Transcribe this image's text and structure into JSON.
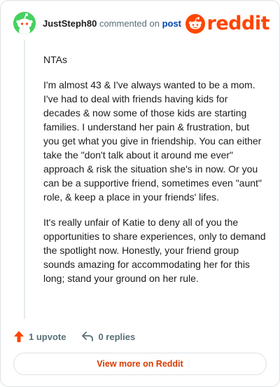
{
  "header": {
    "username": "JustSteph80",
    "verb": "commented on",
    "post_link": "post",
    "logo_text": "reddit"
  },
  "comment": {
    "paragraphs": [
      "NTAs",
      "I'm almost 43 & I've always wanted to be a mom. I've had to deal with friends having kids for decades & now some of those kids are starting families. I understand her pain & frustration, but you get what you give in friendship. You can either take the \"don't talk about it around me ever\" approach & risk the situation she's in now. Or you can be a supportive friend, sometimes even \"aunt\" role, & keep a place in your friends' lifes.",
      "It's really unfair of Katie to deny all of you the opportunities to share experiences, only to demand the spotlight now. Honestly, your friend group sounds amazing for accommodating her for this long; stand your ground on her rule."
    ]
  },
  "actions": {
    "upvote_label": "1 upvote",
    "replies_label": "0 replies"
  },
  "footer": {
    "view_more_label": "View more on Reddit"
  },
  "colors": {
    "brand": "#ff4500",
    "link": "#0045ac",
    "muted": "#576f76",
    "avatar_bg": "#46d160"
  },
  "icons": {
    "avatar": "snoo-avatar-icon",
    "logo": "reddit-snoo-icon",
    "upvote": "upvote-arrow-icon",
    "reply": "reply-arrow-icon"
  }
}
